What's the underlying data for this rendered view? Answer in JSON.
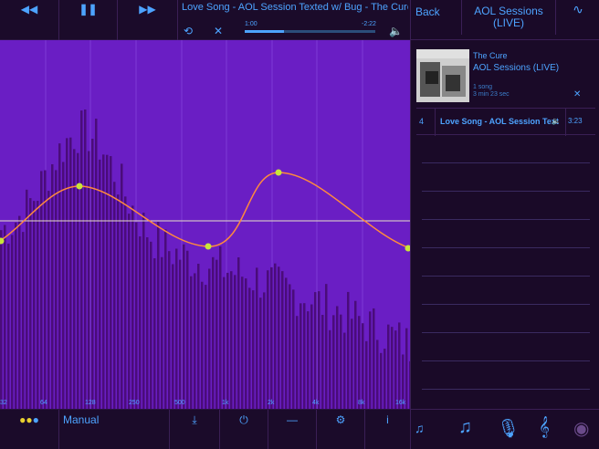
{
  "topbar": {
    "rewind_icon": "rewind-icon",
    "pause_icon": "pause-icon",
    "forward_icon": "fast-forward-icon",
    "title": "Love Song - AOL Session Texted w/ Bug - The Cure",
    "elapsed": "1:00",
    "remaining": "-2:22",
    "progress": 0.3
  },
  "eq": {
    "mode": "Manual",
    "freq_labels": [
      "32",
      "64",
      "128",
      "250",
      "500",
      "1k",
      "2k",
      "4k",
      "8k",
      "16k"
    ],
    "colors": {
      "background": "#6a1ec4",
      "bars": "#4a0c7a",
      "curve": "#ff8a3d",
      "node": "#c8e63a",
      "baseline": "#e8e0c8"
    }
  },
  "panel": {
    "back": "Back",
    "album_title": "AOL Sessions (LIVE)",
    "artist": "The Cure",
    "album_name": "AOL Sessions (LIVE)",
    "song_count": "1 song",
    "duration": "3 min 23 sec",
    "track": {
      "number": "4",
      "name": "Love Song - AOL Session Texted w/ Bug",
      "duration": "3:23"
    }
  }
}
